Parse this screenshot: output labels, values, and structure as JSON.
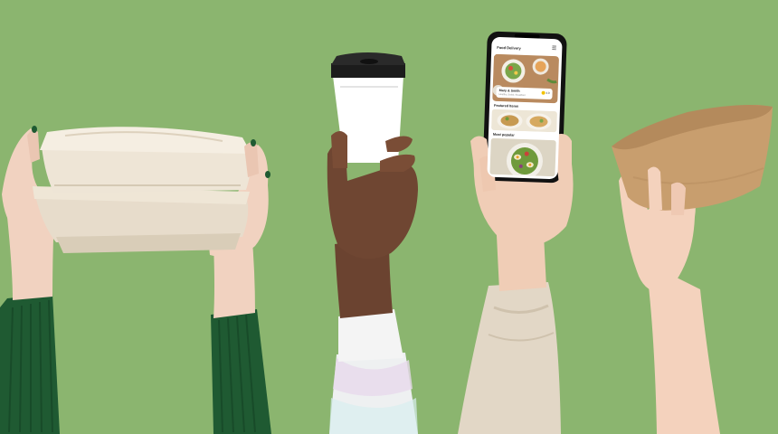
{
  "scene": {
    "background_color": "#8bb56f",
    "objects": [
      "takeout-food-boxes",
      "coffee-cup",
      "smartphone",
      "kraft-bowl"
    ]
  },
  "phone": {
    "app_title": "Food Delivery",
    "menu_icon": "hamburger-menu-icon",
    "featured_card": {
      "name": "Mary & Smith",
      "subtitle": "Healthy, Salad, Breakfast",
      "rating": "4.9"
    },
    "section_featured": "Featured Items",
    "section_popular": "Most popular"
  }
}
